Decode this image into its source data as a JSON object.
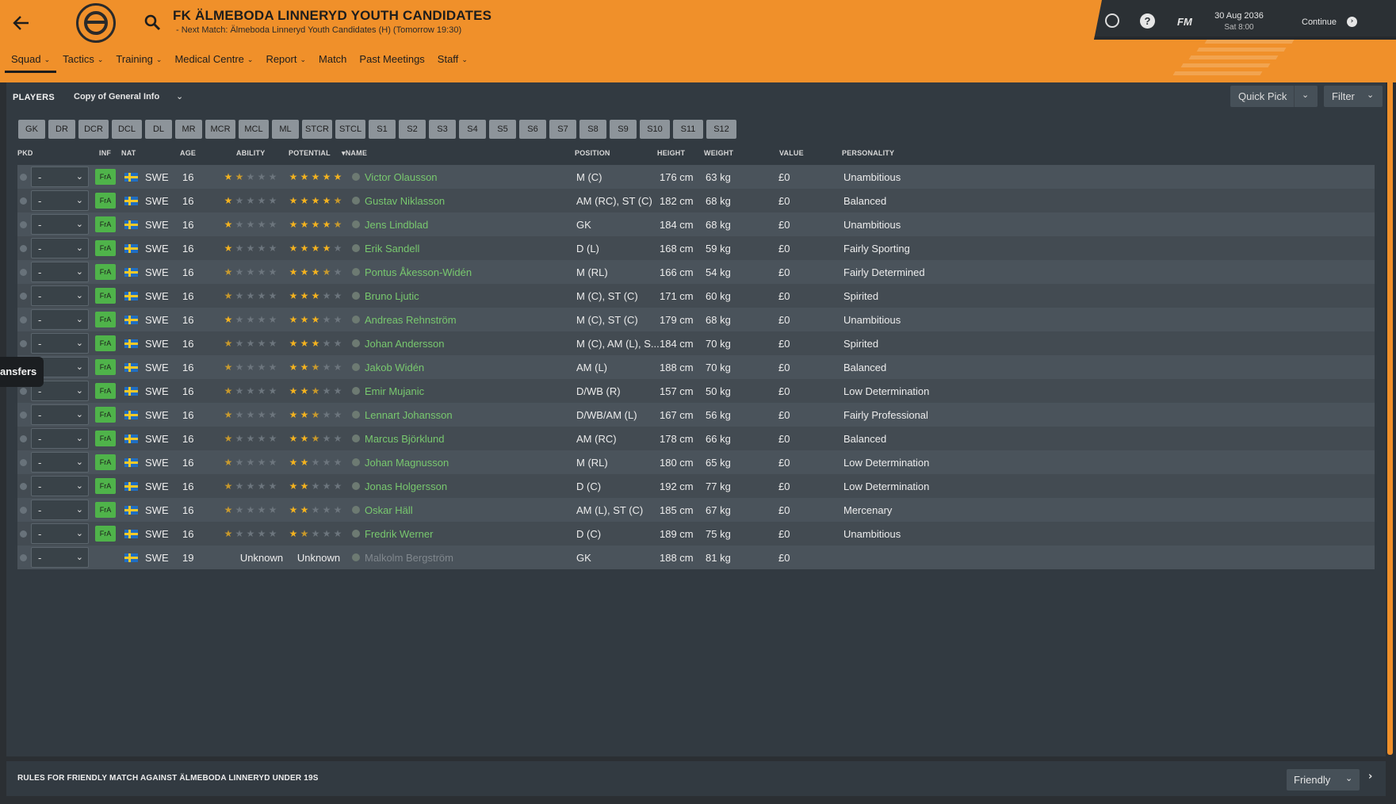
{
  "header": {
    "title": "FK ÄLMEBODA LINNERYD YOUTH CANDIDATES",
    "next_match": "- Next Match: Älmeboda Linneryd Youth Candidates (H) (Tomorrow 19:30)"
  },
  "nav": {
    "items": [
      {
        "label": "Squad",
        "has_menu": true
      },
      {
        "label": "Tactics",
        "has_menu": true
      },
      {
        "label": "Training",
        "has_menu": true
      },
      {
        "label": "Medical Centre",
        "has_menu": true
      },
      {
        "label": "Report",
        "has_menu": true
      },
      {
        "label": "Match",
        "has_menu": false
      },
      {
        "label": "Past Meetings",
        "has_menu": false
      },
      {
        "label": "Staff",
        "has_menu": true
      }
    ]
  },
  "top_right": {
    "fm_label": "FM",
    "date": "30 Aug 2036",
    "time": "Sat 8:00",
    "continue_label": "Continue"
  },
  "panel": {
    "label": "PLAYERS",
    "view": "Copy of General Info",
    "quick_pick": "Quick Pick",
    "filter": "Filter"
  },
  "position_filters": [
    "GK",
    "DR",
    "DCR",
    "DCL",
    "DL",
    "MR",
    "MCR",
    "MCL",
    "ML",
    "STCR",
    "STCL",
    "S1",
    "S2",
    "S3",
    "S4",
    "S5",
    "S6",
    "S7",
    "S8",
    "S9",
    "S10",
    "S11",
    "S12"
  ],
  "columns": {
    "pkd": "PKD",
    "inf": "INF",
    "nat": "NAT",
    "age": "AGE",
    "ability": "ABILITY",
    "potential": "POTENTIAL",
    "name": "NAME",
    "position": "POSITION",
    "height": "HEIGHT",
    "weight": "WEIGHT",
    "value": "VALUE",
    "personality": "PERSONALITY"
  },
  "players": [
    {
      "pkd": "-",
      "inf": "FrA",
      "nat": "SWE",
      "age": "16",
      "ability": 1.5,
      "potential": 5,
      "name": "Victor Olausson",
      "position": "M (C)",
      "height": "176 cm",
      "weight": "63 kg",
      "value": "£0",
      "personality": "Unambitious"
    },
    {
      "pkd": "-",
      "inf": "FrA",
      "nat": "SWE",
      "age": "16",
      "ability": 1,
      "potential": 4.5,
      "name": "Gustav Niklasson",
      "position": "AM (RC), ST (C)",
      "height": "182 cm",
      "weight": "68 kg",
      "value": "£0",
      "personality": "Balanced"
    },
    {
      "pkd": "-",
      "inf": "FrA",
      "nat": "SWE",
      "age": "16",
      "ability": 1,
      "potential": 4.5,
      "name": "Jens Lindblad",
      "position": "GK",
      "height": "184 cm",
      "weight": "68 kg",
      "value": "£0",
      "personality": "Unambitious"
    },
    {
      "pkd": "-",
      "inf": "FrA",
      "nat": "SWE",
      "age": "16",
      "ability": 1,
      "potential": 4,
      "name": "Erik Sandell",
      "position": "D (L)",
      "height": "168 cm",
      "weight": "59 kg",
      "value": "£0",
      "personality": "Fairly Sporting"
    },
    {
      "pkd": "-",
      "inf": "FrA",
      "nat": "SWE",
      "age": "16",
      "ability": 0.5,
      "potential": 3.5,
      "name": "Pontus Åkesson-Widén",
      "position": "M (RL)",
      "height": "166 cm",
      "weight": "54 kg",
      "value": "£0",
      "personality": "Fairly Determined"
    },
    {
      "pkd": "-",
      "inf": "FrA",
      "nat": "SWE",
      "age": "16",
      "ability": 0.5,
      "potential": 3,
      "name": "Bruno Ljutic",
      "position": "M (C), ST (C)",
      "height": "171 cm",
      "weight": "60 kg",
      "value": "£0",
      "personality": "Spirited"
    },
    {
      "pkd": "-",
      "inf": "FrA",
      "nat": "SWE",
      "age": "16",
      "ability": 1,
      "potential": 3,
      "name": "Andreas Rehnström",
      "position": "M (C), ST (C)",
      "height": "179 cm",
      "weight": "68 kg",
      "value": "£0",
      "personality": "Unambitious"
    },
    {
      "pkd": "-",
      "inf": "FrA",
      "nat": "SWE",
      "age": "16",
      "ability": 0.5,
      "potential": 3,
      "name": "Johan Andersson",
      "position": "M (C), AM (L), S...",
      "height": "184 cm",
      "weight": "70 kg",
      "value": "£0",
      "personality": "Spirited"
    },
    {
      "pkd": "-",
      "inf": "FrA",
      "nat": "SWE",
      "age": "16",
      "ability": 0.5,
      "potential": 2.5,
      "name": "Jakob Widén",
      "position": "AM (L)",
      "height": "188 cm",
      "weight": "70 kg",
      "value": "£0",
      "personality": "Balanced"
    },
    {
      "pkd": "-",
      "inf": "FrA",
      "nat": "SWE",
      "age": "16",
      "ability": 0.5,
      "potential": 2.5,
      "name": "Emir Mujanic",
      "position": "D/WB (R)",
      "height": "157 cm",
      "weight": "50 kg",
      "value": "£0",
      "personality": "Low Determination"
    },
    {
      "pkd": "-",
      "inf": "FrA",
      "nat": "SWE",
      "age": "16",
      "ability": 0.5,
      "potential": 2.5,
      "name": "Lennart Johansson",
      "position": "D/WB/AM (L)",
      "height": "167 cm",
      "weight": "56 kg",
      "value": "£0",
      "personality": "Fairly Professional"
    },
    {
      "pkd": "-",
      "inf": "FrA",
      "nat": "SWE",
      "age": "16",
      "ability": 0.5,
      "potential": 2.5,
      "name": "Marcus Björklund",
      "position": "AM (RC)",
      "height": "178 cm",
      "weight": "66 kg",
      "value": "£0",
      "personality": "Balanced"
    },
    {
      "pkd": "-",
      "inf": "FrA",
      "nat": "SWE",
      "age": "16",
      "ability": 0.5,
      "potential": 2,
      "name": "Johan Magnusson",
      "position": "M (RL)",
      "height": "180 cm",
      "weight": "65 kg",
      "value": "£0",
      "personality": "Low Determination"
    },
    {
      "pkd": "-",
      "inf": "FrA",
      "nat": "SWE",
      "age": "16",
      "ability": 0.5,
      "potential": 2,
      "name": "Jonas Holgersson",
      "position": "D (C)",
      "height": "192 cm",
      "weight": "77 kg",
      "value": "£0",
      "personality": "Low Determination"
    },
    {
      "pkd": "-",
      "inf": "FrA",
      "nat": "SWE",
      "age": "16",
      "ability": 0.5,
      "potential": 2,
      "name": "Oskar Häll",
      "position": "AM (L), ST (C)",
      "height": "185 cm",
      "weight": "67 kg",
      "value": "£0",
      "personality": "Mercenary"
    },
    {
      "pkd": "-",
      "inf": "FrA",
      "nat": "SWE",
      "age": "16",
      "ability": 0.5,
      "potential": 1.5,
      "name": "Fredrik Werner",
      "position": "D (C)",
      "height": "189 cm",
      "weight": "75 kg",
      "value": "£0",
      "personality": "Unambitious"
    },
    {
      "pkd": "-",
      "inf": "",
      "nat": "SWE",
      "age": "19",
      "ability": "Unknown",
      "potential": "Unknown",
      "name": "Malkolm Bergström",
      "position": "GK",
      "height": "188 cm",
      "weight": "81 kg",
      "value": "£0",
      "personality": ""
    }
  ],
  "side_tab": {
    "label": "ansfers"
  },
  "footer": {
    "rules_text": "RULES FOR FRIENDLY MATCH AGAINST ÄLMEBODA LINNERYD UNDER 19S",
    "match_type": "Friendly"
  },
  "colors": {
    "header": "#f0902a",
    "panel": "#323a41",
    "name_link": "#78c86e",
    "star": "#f3b21f",
    "inf_badge": "#4fb34a"
  }
}
